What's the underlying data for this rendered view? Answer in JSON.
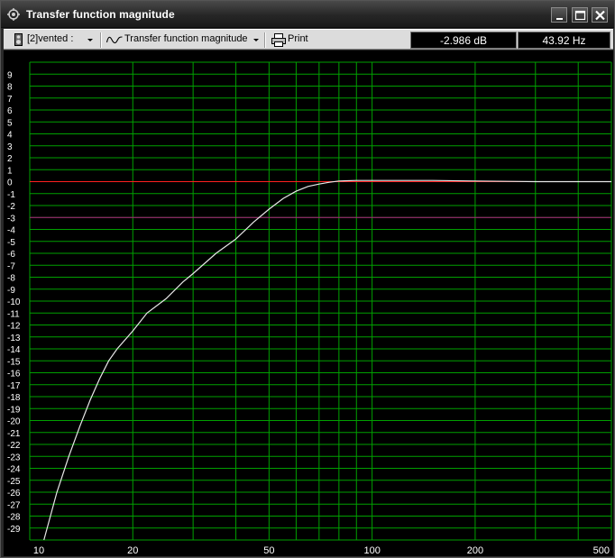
{
  "window": {
    "title": "Transfer function magnitude",
    "icon": "speaker-gear-icon",
    "controls": [
      "minimize-icon",
      "maximize-icon",
      "close-icon"
    ]
  },
  "toolbar": {
    "driver_select": "[2]vented :",
    "graph_select": "Transfer function magnitude",
    "print_label": "Print",
    "readout_db": "-2.986 dB",
    "readout_hz": "43.92 Hz"
  },
  "colors": {
    "grid": "#00a000",
    "reference_0db": "#ff2020",
    "reference_minus3db": "#b01880",
    "curve": "#e8e8e8"
  },
  "chart_data": {
    "type": "line",
    "x_scale": "log",
    "xlim": [
      10,
      500
    ],
    "ylim": [
      -30,
      10
    ],
    "x_tick_labels": [
      "10",
      "20",
      "50",
      "100",
      "200",
      "500"
    ],
    "y_tick_labels": [
      "9",
      "8",
      "7",
      "6",
      "5",
      "4",
      "3",
      "2",
      "1",
      "0",
      "-1",
      "-2",
      "-3",
      "-4",
      "-5",
      "-6",
      "-7",
      "-8",
      "-9",
      "-10",
      "-11",
      "-12",
      "-13",
      "-14",
      "-15",
      "-16",
      "-17",
      "-18",
      "-19",
      "-20",
      "-21",
      "-22",
      "-23",
      "-24",
      "-25",
      "-26",
      "-27",
      "-28",
      "-29"
    ],
    "grid": true,
    "reference_lines": [
      {
        "y": 0,
        "color": "#ff2020"
      },
      {
        "y": -3,
        "color": "#b01880"
      }
    ],
    "series": [
      {
        "x": [
          11,
          12,
          13,
          14,
          15,
          16,
          17,
          18,
          20,
          22,
          25,
          28,
          30,
          35,
          40,
          45,
          50,
          55,
          60,
          65,
          70,
          75,
          80,
          90,
          100,
          150,
          200,
          250,
          300,
          500
        ],
        "y": [
          -30,
          -26,
          -23,
          -20.5,
          -18.3,
          -16.5,
          -15,
          -14,
          -12.5,
          -11,
          -9.8,
          -8.4,
          -7.7,
          -6,
          -4.8,
          -3.4,
          -2.3,
          -1.4,
          -0.8,
          -0.4,
          -0.2,
          -0.05,
          0.05,
          0.1,
          0.1,
          0.1,
          0.05,
          0.02,
          0,
          0
        ]
      }
    ]
  }
}
